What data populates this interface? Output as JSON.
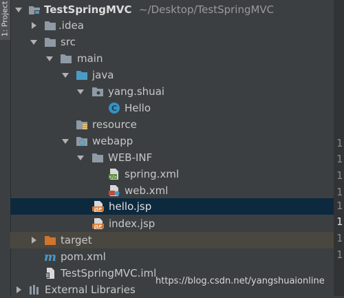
{
  "side_tab": {
    "label": "1: Project"
  },
  "tree": {
    "root": {
      "name": "TestSpringMVC",
      "path": "~/Desktop/TestSpringMVC"
    },
    "idea": "idea",
    "src": "src",
    "main": "main",
    "java": "java",
    "package": "yang.shuai",
    "hello_class": "Hello",
    "resource": "resource",
    "webapp": "webapp",
    "webinf": "WEB-INF",
    "spring_xml": "spring.xml",
    "web_xml": "web.xml",
    "hello_jsp": "hello.jsp",
    "index_jsp": "index.jsp",
    "target": "target",
    "pom": "pom.xml",
    "iml": "TestSpringMVC.iml",
    "external": "External Libraries"
  },
  "gutter": [
    "1",
    "1",
    "1",
    "1",
    "1",
    "1",
    "1",
    "1"
  ],
  "watermark": "https://blog.csdn.net/yangshuaionline",
  "colors": {
    "selected_row": "#0d293e",
    "excluded_row": "#4a4740",
    "folder": "#8e9aa5",
    "source_folder": "#4a9cc7",
    "excluded_folder": "#d2742a",
    "class_icon": "#3592c4"
  },
  "icons": {
    "project": "project-folder-icon",
    "folder": "folder-icon",
    "source": "source-folder-icon",
    "package": "package-icon",
    "class": "class-icon",
    "resource": "resource-folder-icon",
    "web": "web-folder-icon",
    "xml": "xml-file-icon",
    "jsp": "jsp-file-icon",
    "excluded": "excluded-folder-icon",
    "maven": "maven-icon",
    "iml": "module-file-icon",
    "library": "library-icon"
  }
}
